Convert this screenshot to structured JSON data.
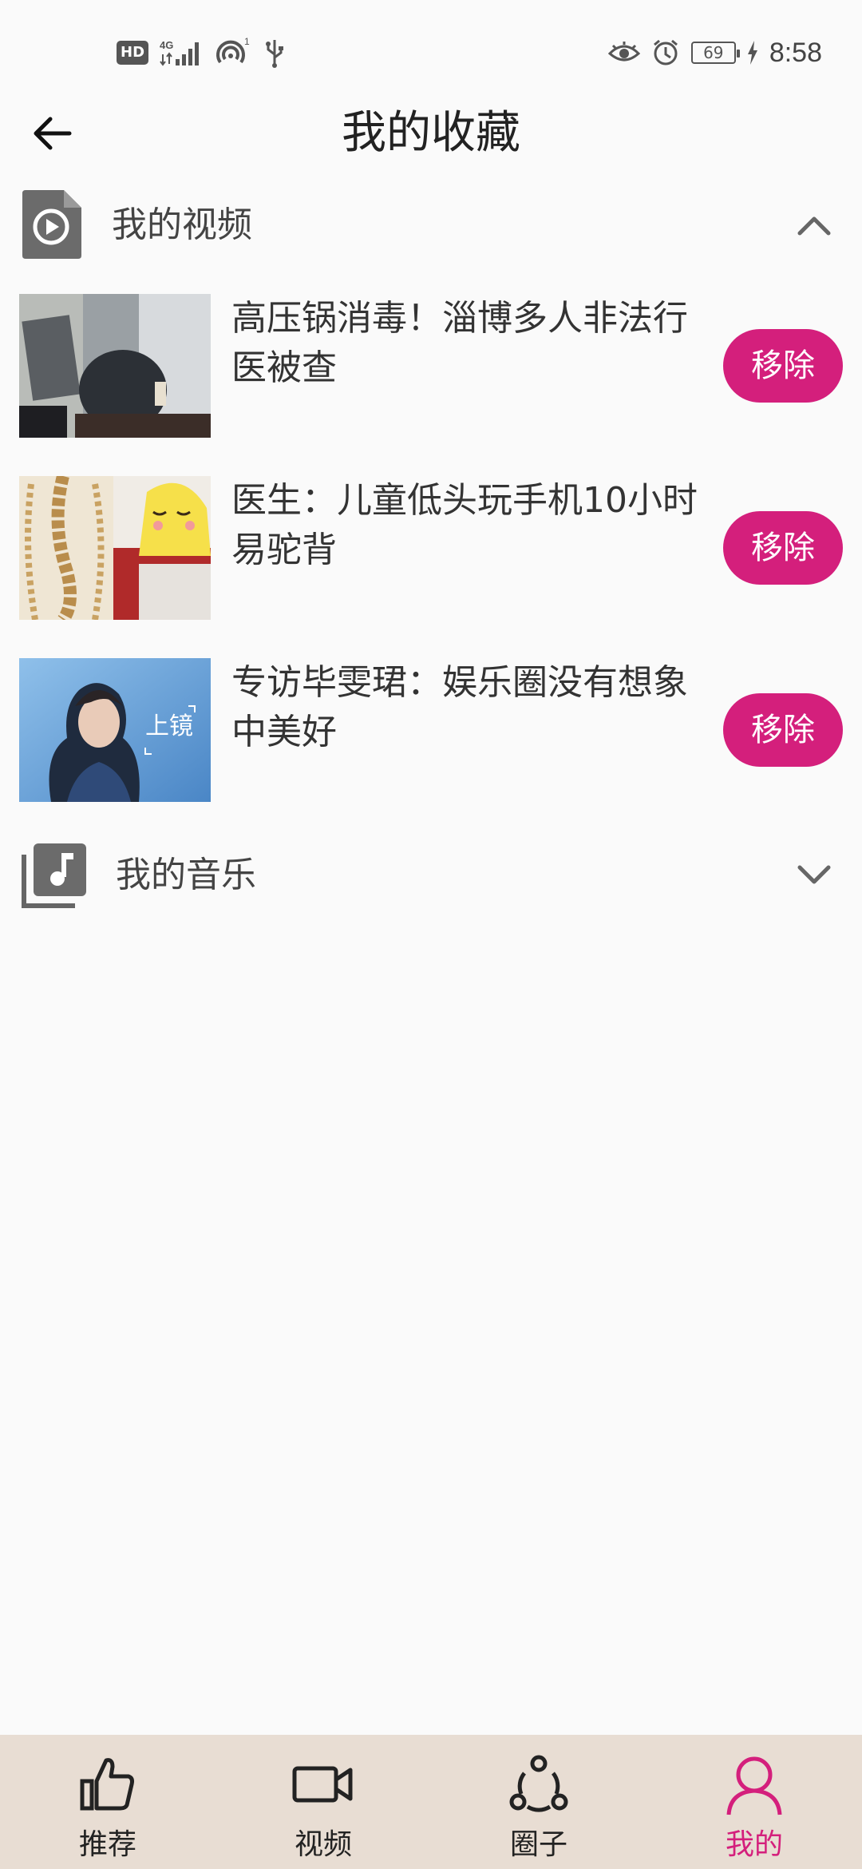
{
  "status_bar": {
    "hd": "HD",
    "network": "4G",
    "hotspot_count": "1",
    "battery": "69",
    "time": "8:58"
  },
  "header": {
    "title": "我的收藏"
  },
  "sections": {
    "videos": {
      "title": "我的视频",
      "expanded": true,
      "items": [
        {
          "title": "高压锅消毒！淄博多人非法行医被查",
          "remove_label": "移除"
        },
        {
          "title": "医生：儿童低头玩手机10小时易驼背",
          "remove_label": "移除"
        },
        {
          "title": "专访毕雯珺：娱乐圈没有想象中美好",
          "remove_label": "移除",
          "thumb_overlay": "上镜"
        }
      ]
    },
    "music": {
      "title": "我的音乐",
      "expanded": false
    }
  },
  "bottom_nav": {
    "items": [
      {
        "label": "推荐",
        "icon": "thumbs-up-icon",
        "active": false
      },
      {
        "label": "视频",
        "icon": "video-camera-icon",
        "active": false
      },
      {
        "label": "圈子",
        "icon": "circle-share-icon",
        "active": false
      },
      {
        "label": "我的",
        "icon": "person-icon",
        "active": true
      }
    ]
  },
  "colors": {
    "accent": "#d41f7c",
    "nav_background": "#e8ddd3",
    "page_background": "#fafafa"
  }
}
